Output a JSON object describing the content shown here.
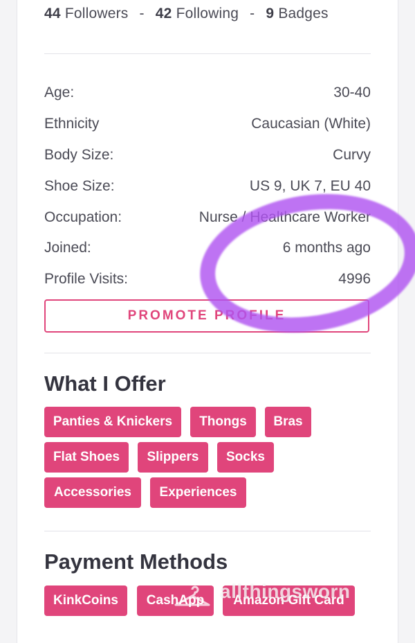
{
  "stats": {
    "followers_count": "44",
    "followers_label": "Followers",
    "following_count": "42",
    "following_label": "Following",
    "badges_count": "9",
    "badges_label": "Badges",
    "separator_1": "-",
    "separator_2": "-"
  },
  "details": [
    {
      "label": "Age:",
      "value": "30-40"
    },
    {
      "label": "Ethnicity",
      "value": "Caucasian (White)"
    },
    {
      "label": "Body Size:",
      "value": "Curvy"
    },
    {
      "label": "Shoe Size:",
      "value": "US 9, UK 7, EU 40"
    },
    {
      "label": "Occupation:",
      "value": "Nurse / Healthcare Worker"
    },
    {
      "label": "Joined:",
      "value": "6 months ago"
    },
    {
      "label": "Profile Visits:",
      "value": "4996"
    }
  ],
  "promote_label": "PROMOTE PROFILE",
  "offer": {
    "title": "What I Offer",
    "tags": [
      "Panties & Knickers",
      "Thongs",
      "Bras",
      "Flat Shoes",
      "Slippers",
      "Socks",
      "Accessories",
      "Experiences"
    ]
  },
  "payment": {
    "title": "Payment Methods",
    "tags": [
      "KinkCoins",
      "CashApp",
      "Amazon Gift Card"
    ]
  },
  "watermark": "allthingsworn",
  "colors": {
    "accent": "#e0457b",
    "highlight_ring": "#b054f0"
  }
}
